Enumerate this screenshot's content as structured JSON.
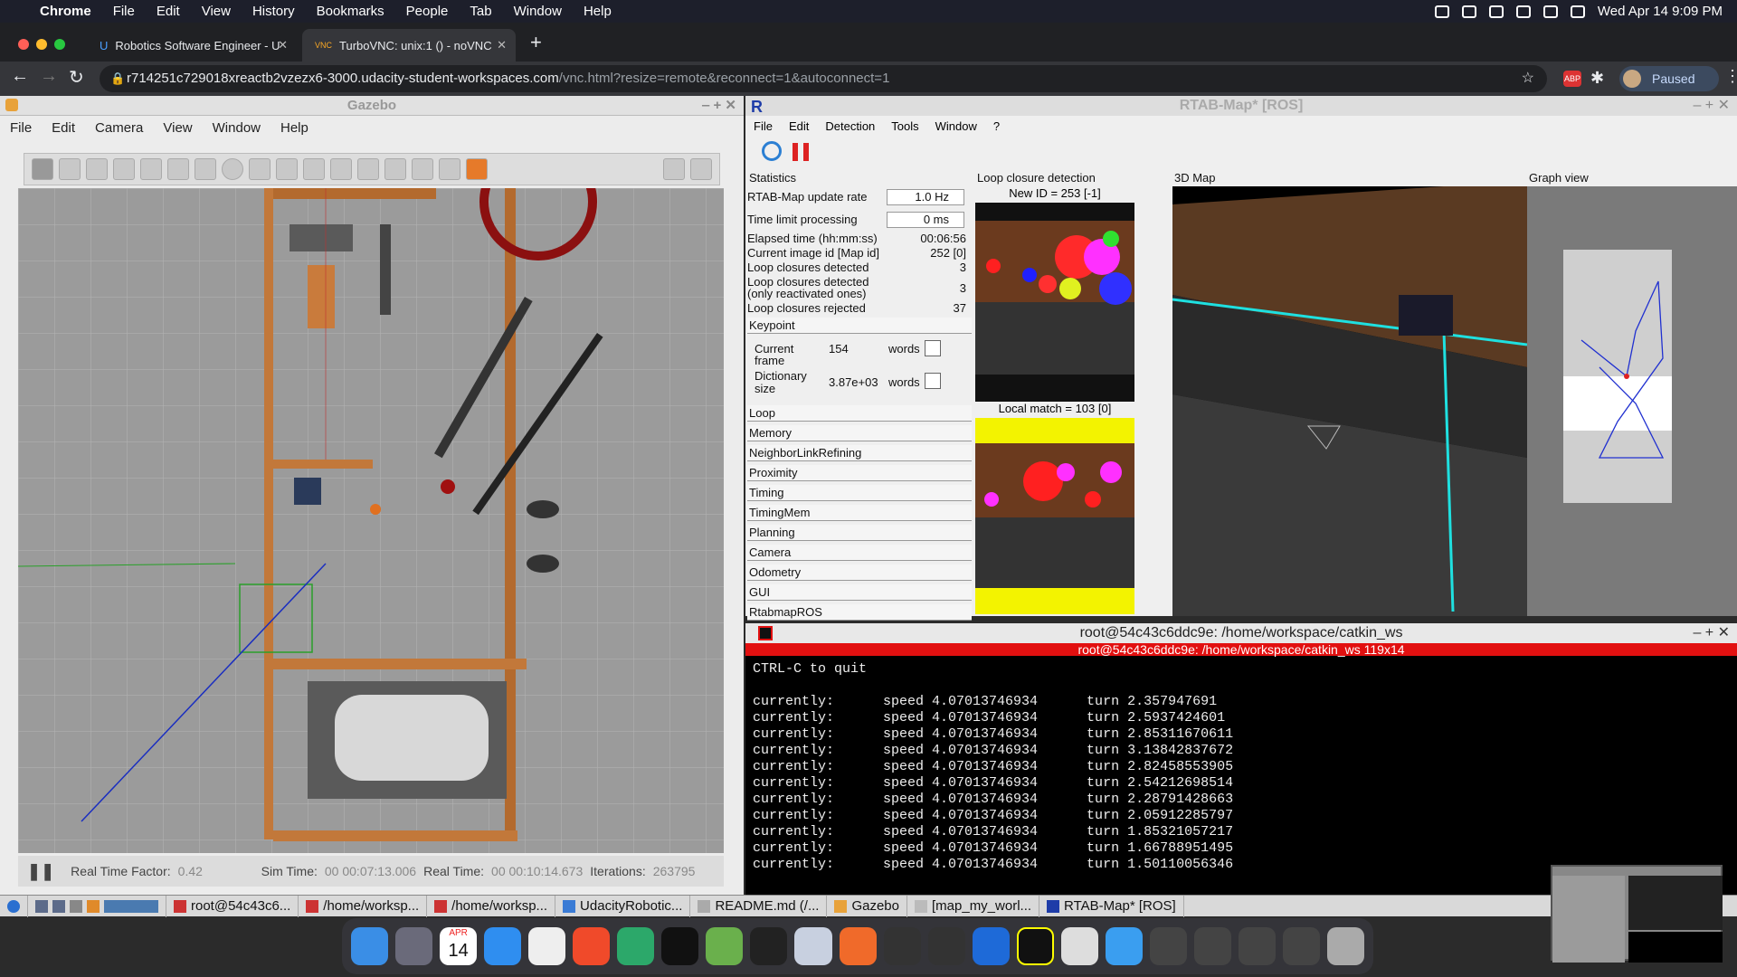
{
  "mac": {
    "app": "Chrome",
    "menus": [
      "File",
      "Edit",
      "View",
      "History",
      "Bookmarks",
      "People",
      "Tab",
      "Window",
      "Help"
    ],
    "clock": "Wed Apr 14  9:09 PM"
  },
  "chrome": {
    "tabs": [
      {
        "label": "Robotics Software Engineer - U"
      },
      {
        "label": "TurboVNC: unix:1 () - noVNC"
      }
    ],
    "url_main": "r714251c729018xreactb2vzezx6-3000.udacity-student-workspaces.com",
    "url_rest": "/vnc.html?resize=remote&reconnect=1&autoconnect=1",
    "profile": "Paused"
  },
  "gazebo": {
    "title": "Gazebo",
    "menus": [
      "File",
      "Edit",
      "Camera",
      "View",
      "Window",
      "Help"
    ],
    "rtf_label": "Real Time Factor:",
    "rtf": "0.42",
    "sim_label": "Sim Time:",
    "sim": "00 00:07:13.006",
    "real_label": "Real Time:",
    "real": "00 00:10:14.673",
    "iter_label": "Iterations:",
    "iter": "263795"
  },
  "rtab": {
    "title": "RTAB-Map* [ROS]",
    "menus": [
      "File",
      "Edit",
      "Detection",
      "Tools",
      "Window",
      "?"
    ],
    "docks": {
      "stats": "Statistics",
      "loop": "Loop closure detection",
      "map": "3D Map",
      "graph": "Graph view"
    },
    "new_id": "New ID = 253 [-1]",
    "local_match": "Local match = 103 [0]",
    "update_label": "RTAB-Map update rate",
    "update_val": "1.0 Hz",
    "limit_label": "Time limit processing",
    "limit_val": "0 ms",
    "stats": [
      {
        "k": "Elapsed time (hh:mm:ss)",
        "v": "00:06:56"
      },
      {
        "k": "Current image id [Map id]",
        "v": "252 [0]"
      },
      {
        "k": "Loop closures detected",
        "v": "3"
      },
      {
        "k": "Loop closures detected",
        "v": ""
      },
      {
        "k": "(only reactivated ones)",
        "v": "3"
      },
      {
        "k": "Loop closures rejected",
        "v": "37"
      }
    ],
    "keypoint": "Keypoint",
    "kp_rows": [
      {
        "k1": "Current",
        "k2": "frame",
        "v": "154",
        "u": "words"
      },
      {
        "k1": "Dictionary",
        "k2": "size",
        "v": "3.87e+03",
        "u": "words"
      }
    ],
    "sections": [
      "Loop",
      "Memory",
      "NeighborLinkRefining",
      "Proximity",
      "Timing",
      "TimingMem",
      "Planning",
      "Camera",
      "Odometry",
      "GUI",
      "RtabmapROS"
    ]
  },
  "terminal": {
    "title": "root@54c43c6ddc9e: /home/workspace/catkin_ws",
    "sub": "root@54c43c6ddc9e: /home/workspace/catkin_ws 119x14",
    "lines": [
      "CTRL-C to quit",
      "",
      "currently:      speed 4.07013746934      turn 2.357947691",
      "currently:      speed 4.07013746934      turn 2.5937424601",
      "currently:      speed 4.07013746934      turn 2.85311670611",
      "currently:      speed 4.07013746934      turn 3.13842837672",
      "currently:      speed 4.07013746934      turn 2.82458553905",
      "currently:      speed 4.07013746934      turn 2.54212698514",
      "currently:      speed 4.07013746934      turn 2.28791428663",
      "currently:      speed 4.07013746934      turn 2.05912285797",
      "currently:      speed 4.07013746934      turn 1.85321057217",
      "currently:      speed 4.07013746934      turn 1.66788951495",
      "currently:      speed 4.07013746934      turn 1.50110056346"
    ]
  },
  "taskbar": [
    "root@54c43c6...",
    "/home/worksp...",
    "/home/worksp...",
    "UdacityRobotic...",
    "README.md (/...",
    "Gazebo",
    "[map_my_worl...",
    "RTAB-Map* [ROS]"
  ],
  "dock_date": {
    "month": "APR",
    "day": "14"
  }
}
